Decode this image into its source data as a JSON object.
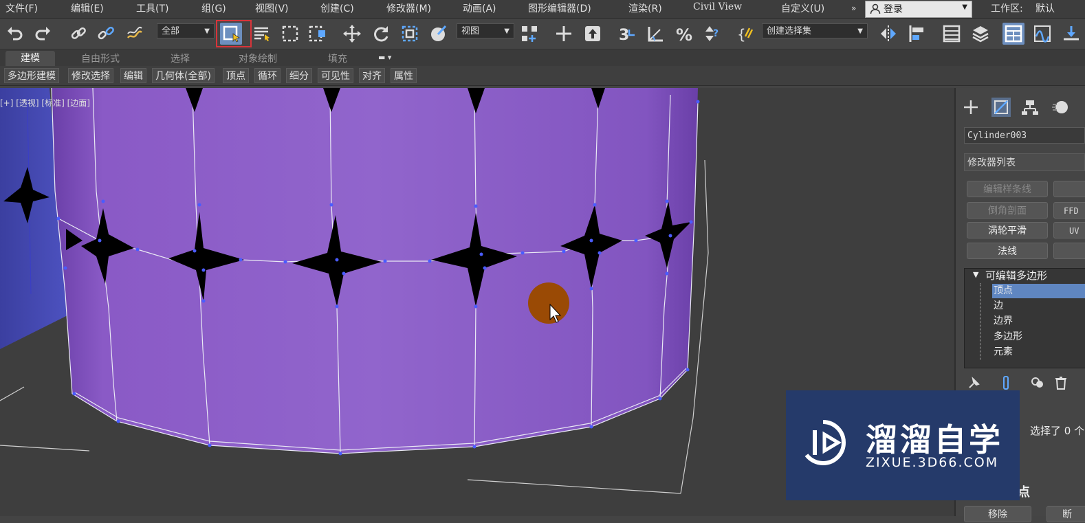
{
  "menubar": {
    "items": [
      "文件(F)",
      "编辑(E)",
      "工具(T)",
      "组(G)",
      "视图(V)",
      "创建(C)",
      "修改器(M)",
      "动画(A)",
      "图形编辑器(D)",
      "渲染(R)",
      "Civil View",
      "自定义(U)"
    ],
    "login_label": "登录",
    "workspace_label": "工作区:",
    "workspace_value": "默认"
  },
  "toolbar": {
    "filter_dropdown": "全部",
    "view_dropdown": "视图",
    "selection_set_dropdown": "创建选择集"
  },
  "ribbon": {
    "tabs": [
      "建模",
      "自由形式",
      "选择",
      "对象绘制",
      "填充"
    ],
    "buttons": [
      "多边形建模",
      "修改选择",
      "编辑",
      "几何体(全部)",
      "顶点",
      "循环",
      "细分",
      "可见性",
      "对齐",
      "属性"
    ]
  },
  "viewport": {
    "label": "[+] [透视] [标准] [边面]"
  },
  "panel": {
    "object_name": "Cylinder003",
    "modifier_list": "修改器列表",
    "modifier_buttons": [
      "编辑样条线",
      "倒角剖面",
      "涡轮平滑",
      "法线"
    ],
    "right_buttons": [
      "FFD",
      "UV"
    ],
    "stack_root": "可编辑多边形",
    "stack_items": [
      "顶点",
      "边",
      "边界",
      "多边形",
      "元素"
    ],
    "selected_text": "选择了 0 个",
    "section_label": "点",
    "bottom_buttons": [
      "移除",
      "断"
    ]
  },
  "watermark": {
    "title": "溜溜自学",
    "url": "ZIXUE.3D66.COM"
  },
  "colors": {
    "mesh_purple": "#8c5cc8",
    "highlight_red": "#d9343a",
    "selected_blue": "#5f86c1",
    "cursor_dot": "#9a4a05",
    "watermark_bg": "#253a6a"
  }
}
